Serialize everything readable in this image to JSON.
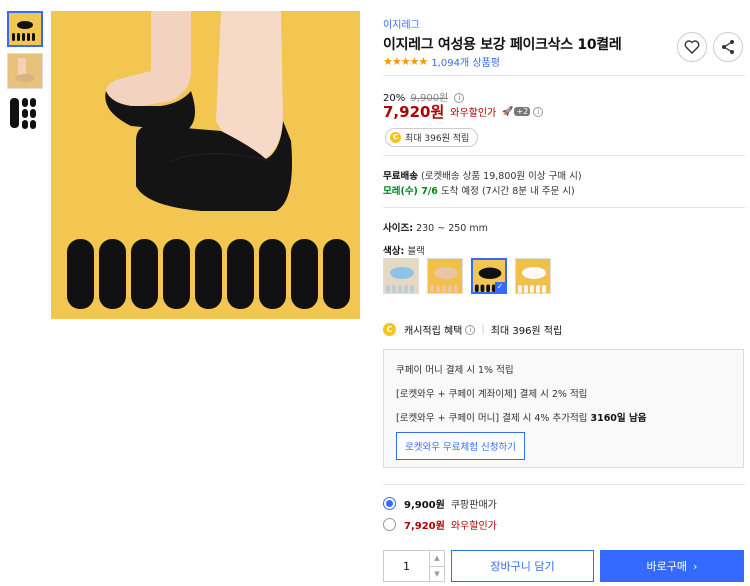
{
  "product": {
    "brand": "이지레그",
    "title": "이지레그 여성용 보강 페이크삭스 10켤레",
    "stars": "★★★★★",
    "review_count": "1,094개 상품평"
  },
  "icons": [
    "heart-icon",
    "share-icon",
    "info-icon",
    "coin-icon",
    "check-icon",
    "chevron-right-icon"
  ],
  "price": {
    "discount_rate": "20%",
    "original_price": "9,900원",
    "sale_price": "7,920원",
    "wow_label": "와우할인가",
    "badge_plus": "+2",
    "cash_pill": "최대 396원 적립"
  },
  "shipping": {
    "free_label": "무료배송",
    "free_detail": "(로켓배송 상품 19,800원 이상 구매 시)",
    "arrival_green": "모레(수) 7/6",
    "arrival_text": "도착 예정",
    "arrival_detail": "(7시간 8분 내 주문 시)"
  },
  "options": {
    "size_label": "사이즈:",
    "size_value": "230 ~ 250 mm",
    "color_label": "색상:",
    "color_value": "블랙",
    "swatch_names": [
      "하늘",
      "베이지",
      "블랙",
      "화이트"
    ]
  },
  "cash": {
    "label": "캐시적립 혜택",
    "value": "최대 396원 적립"
  },
  "benefits": {
    "line1": "쿠페이 머니 결제 시 1% 적립",
    "line2": "[로켓와우 + 쿠페이 계좌이체] 결제 시 2% 적립",
    "line3_prefix": "[로켓와우 + 쿠페이 머니] 결제 시 4% 추가적립",
    "line3_bold": "3160일 남음",
    "trial_button": "로켓와우 무료체험 신청하기"
  },
  "price_options": [
    {
      "price": "9,900원",
      "label": "쿠팡판매가",
      "selected": true
    },
    {
      "price": "7,920원",
      "label": "와우할인가",
      "selected": false
    }
  ],
  "purchase": {
    "quantity": "1",
    "cart_button": "장바구니 담기",
    "buy_button": "바로구매"
  },
  "colors": {
    "accent": "#346aff",
    "price_red": "#ae0000",
    "green": "#00891a",
    "star": "#ff9600",
    "image_bg": "#f3c651"
  }
}
